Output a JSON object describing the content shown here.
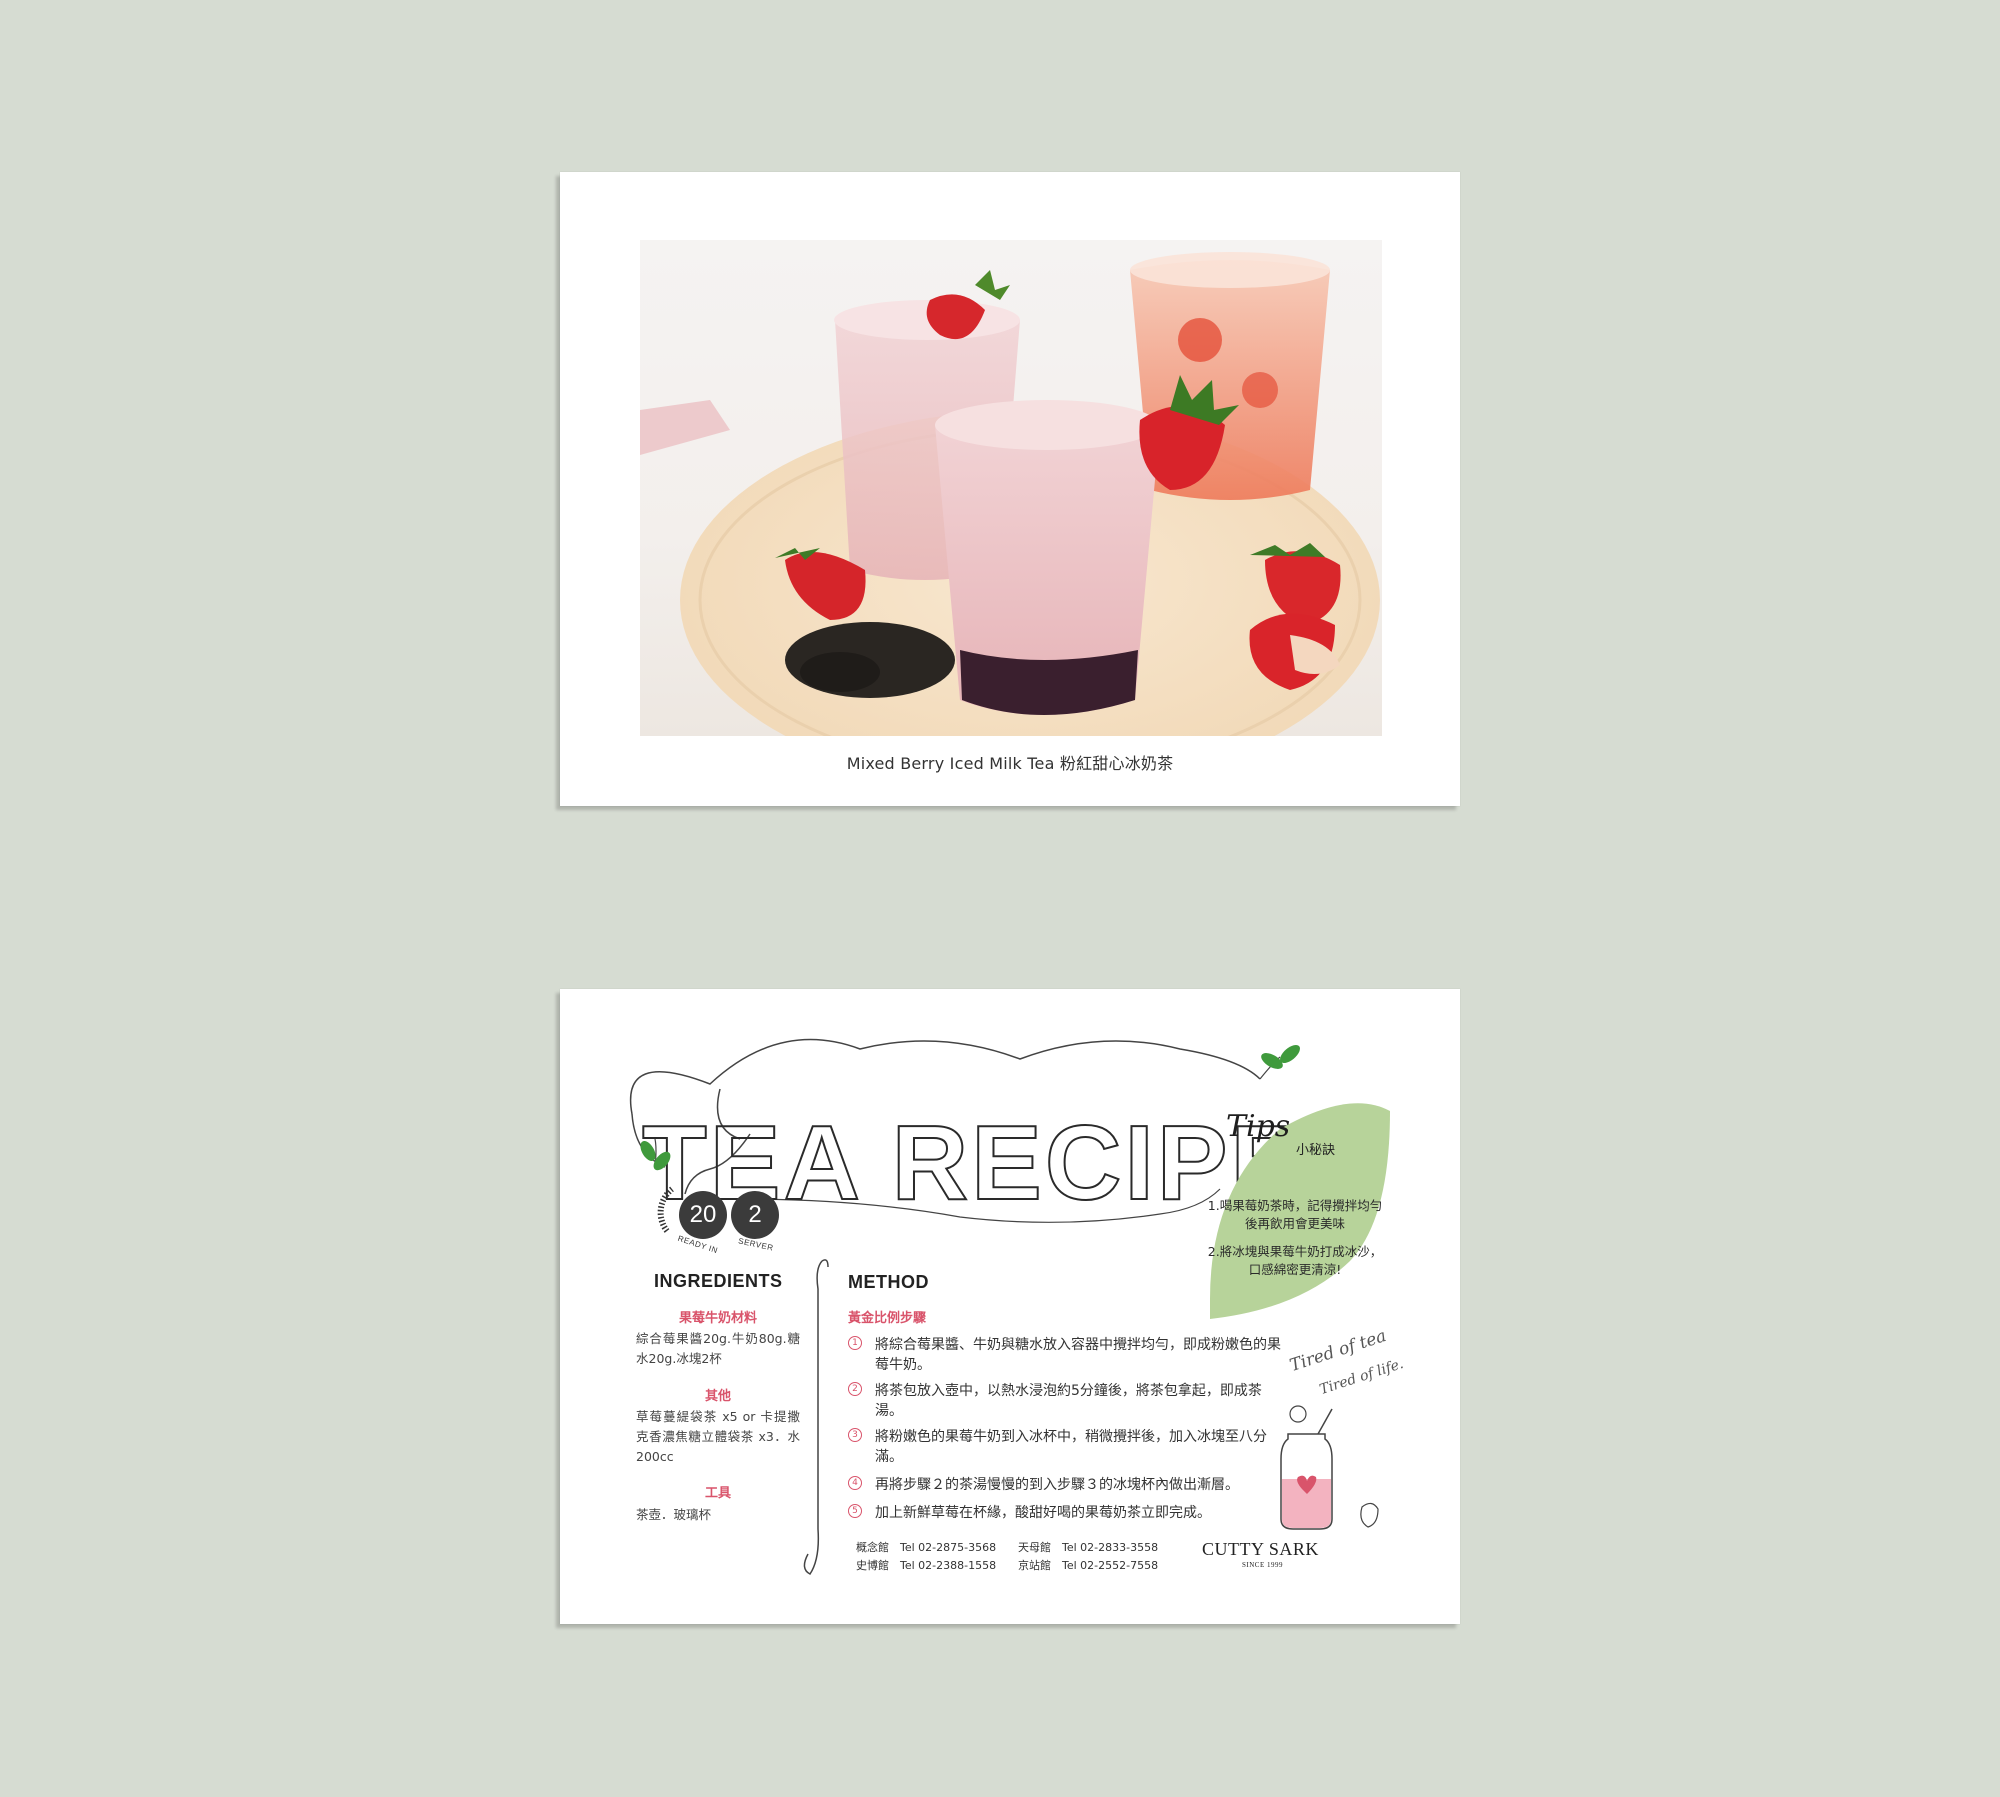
{
  "front": {
    "caption": "Mixed Berry Iced Milk Tea 粉紅甜心冰奶茶"
  },
  "back": {
    "title": "TEA RECIPES",
    "badges": {
      "ready_value": "20",
      "ready_label": "READY IN",
      "server_value": "2",
      "server_label": "SERVER"
    },
    "ingredients": {
      "heading": "INGREDIENTS",
      "groups": [
        {
          "title": "果莓牛奶材料",
          "text": "綜合莓果醬20g.牛奶80g.糖水20g.冰塊2杯"
        },
        {
          "title": "其他",
          "text": "草莓蔓緹袋茶 x5 or 卡提撒克香濃焦糖立體袋茶 x3．水200cc"
        },
        {
          "title": "工具",
          "text": "茶壺．玻璃杯"
        }
      ]
    },
    "method": {
      "heading": "METHOD",
      "subheading": "黃金比例步驟",
      "steps": [
        {
          "num": "1",
          "text": "將綜合莓果醬、牛奶與糖水放入容器中攪拌均勻，即成粉嫩色的果莓牛奶。"
        },
        {
          "num": "2",
          "text": "將茶包放入壺中，以熱水浸泡約5分鐘後，將茶包拿起，即成茶湯。"
        },
        {
          "num": "3",
          "text": "將粉嫩色的果莓牛奶到入冰杯中，稍微攪拌後，加入冰塊至八分滿。"
        },
        {
          "num": "4",
          "text": "再將步驟２的茶湯慢慢的到入步驟３的冰塊杯內做出漸層。"
        },
        {
          "num": "5",
          "text": "加上新鮮草莓在杯緣，酸甜好喝的果莓奶茶立即完成。"
        }
      ]
    },
    "tips": {
      "title": "Tips",
      "subtitle": "小秘訣",
      "items": [
        "1.喝果莓奶茶時，記得攪拌均勻後再飲用會更美味",
        "2.將冰塊與果莓牛奶打成冰沙，口感綿密更清涼!"
      ]
    },
    "slogan": [
      "Tired of tea",
      "Tired of life."
    ],
    "contacts": [
      "概念館　Tel 02-2875-3568",
      "史博館　Tel 02-2388-1558",
      "天母館　Tel 02-2833-3558",
      "京站館　Tel 02-2552-7558"
    ],
    "brand": {
      "name": "CUTTY SARK",
      "since": "SINCE 1999"
    },
    "colors": {
      "accent_pink": "#d9546b",
      "tips_leaf": "#b7d39a",
      "sprout_green": "#3f9a3c"
    }
  }
}
